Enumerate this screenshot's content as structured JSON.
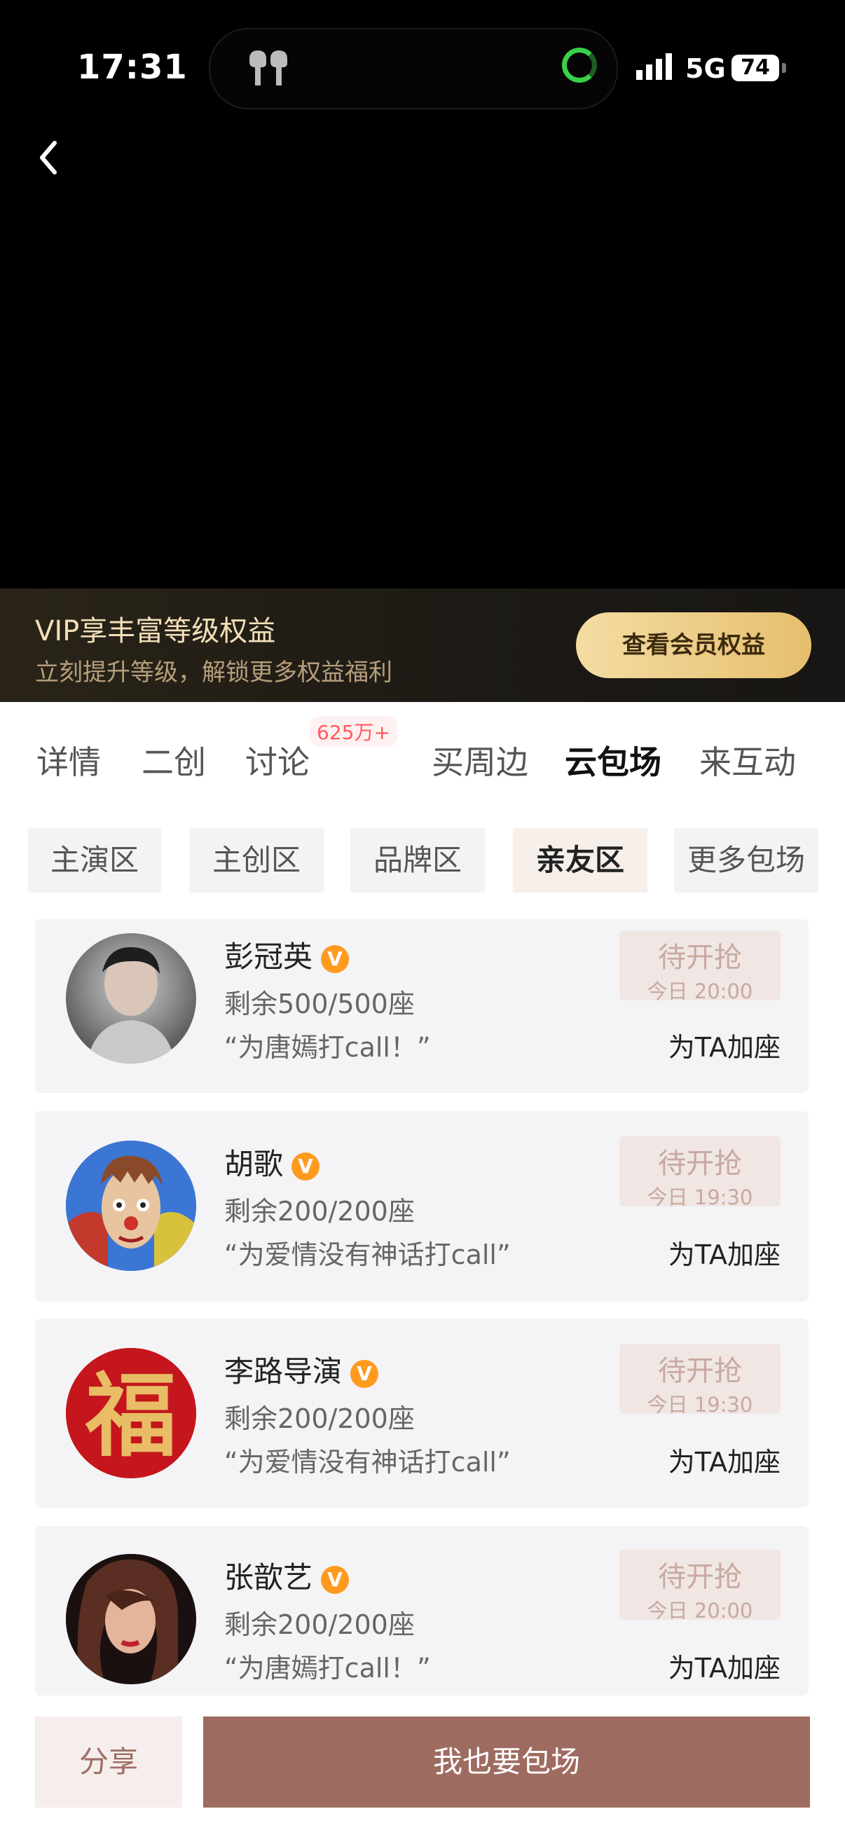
{
  "status_bar": {
    "time": "17:31",
    "network": "5G",
    "battery": "74"
  },
  "vip": {
    "title": "VIP享丰富等级权益",
    "subtitle": "立刻提升等级，解锁更多权益福利",
    "button": "查看会员权益"
  },
  "tabs": [
    {
      "label": "详情"
    },
    {
      "label": "二创"
    },
    {
      "label": "讨论",
      "badge": "625万+"
    },
    {
      "label": "买周边"
    },
    {
      "label": "云包场"
    },
    {
      "label": "来互动"
    }
  ],
  "subtabs": [
    {
      "label": "主演区"
    },
    {
      "label": "主创区"
    },
    {
      "label": "品牌区"
    },
    {
      "label": "亲友区"
    },
    {
      "label": "更多包场"
    }
  ],
  "cards": [
    {
      "name": "彭冠英",
      "seats": "剩余500/500座",
      "message": "“为唐嫣打call！”",
      "status": "待开抢",
      "time": "今日 20:00",
      "action": "为TA加座"
    },
    {
      "name": "胡歌",
      "seats": "剩余200/200座",
      "message": "“为爱情没有神话打call”",
      "status": "待开抢",
      "time": "今日 19:30",
      "action": "为TA加座"
    },
    {
      "name": "李路导演",
      "seats": "剩余200/200座",
      "message": "“为爱情没有神话打call”",
      "status": "待开抢",
      "time": "今日 19:30",
      "action": "为TA加座"
    },
    {
      "name": "张歆艺",
      "seats": "剩余200/200座",
      "message": "“为唐嫣打call！”",
      "status": "待开抢",
      "time": "今日 20:00",
      "action": "为TA加座"
    }
  ],
  "avatar_fu_char": "福",
  "verified_mark": "V",
  "bottom": {
    "share": "分享",
    "book": "我也要包场"
  }
}
